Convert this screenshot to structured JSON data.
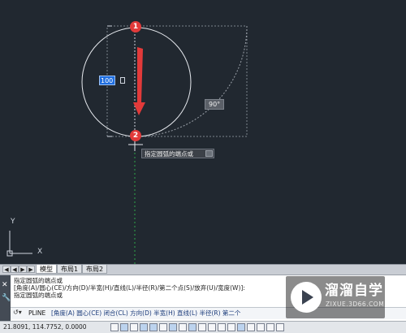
{
  "canvas": {
    "dynamic_input_value": "100",
    "angle_tooltip": "90°",
    "prompt_tooltip": "指定圆弧的端点或",
    "markers": [
      "1",
      "2"
    ],
    "ucs_x_label": "X",
    "ucs_y_label": "Y"
  },
  "layout_tabs": {
    "nav_buttons": [
      "◀",
      "◀",
      "▶",
      "▶"
    ],
    "tabs": [
      "模型",
      "布局1",
      "布局2"
    ],
    "active_tab": "模型"
  },
  "command_window": {
    "history": [
      "指定圆弧的端点或",
      "[角度(A)/圆心(CE)/方向(D)/半宽(H)/直线(L)/半径(R)/第二个点(S)/放弃(U)/宽度(W)]:",
      "指定圆弧的端点或"
    ],
    "input_prefix": "PLINE",
    "input_options": "[角度(A) 圆心(CE) 闭合(CL) 方向(D) 半宽(H) 直线(L) 半径(R) 第二个"
  },
  "status_bar": {
    "coordinates": "21.8091, 114.7752, 0.0000"
  },
  "watermark": {
    "title": "溜溜自学",
    "subtitle": "ZIXUE.3D66.COM"
  },
  "colors": {
    "canvas_bg": "#212830",
    "arrow": "#e23a3a",
    "marker": "#e23a3a",
    "dyn_input_bg": "#1f6ee0"
  }
}
